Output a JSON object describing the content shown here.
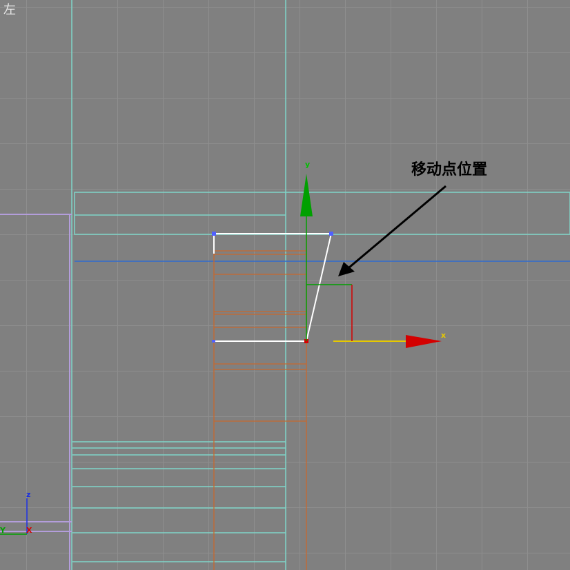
{
  "viewport": {
    "label": "左"
  },
  "annotation": {
    "text": "移动点位置"
  },
  "gizmo": {
    "x_label": "x",
    "y_label": "y"
  },
  "orientation": {
    "z_label": "z",
    "y_label": "Y",
    "x_label": "X"
  },
  "colors": {
    "background": "#808080",
    "grid": "#8e8e8e",
    "cyan": "#7fd6c9",
    "lavender": "#b39ddb",
    "orange": "#c8682c",
    "blue": "#2f6ad0",
    "white": "#ffffff",
    "gizmo_x": "#d40000",
    "gizmo_y": "#00a000",
    "gizmo_plane": "#e6c800"
  }
}
